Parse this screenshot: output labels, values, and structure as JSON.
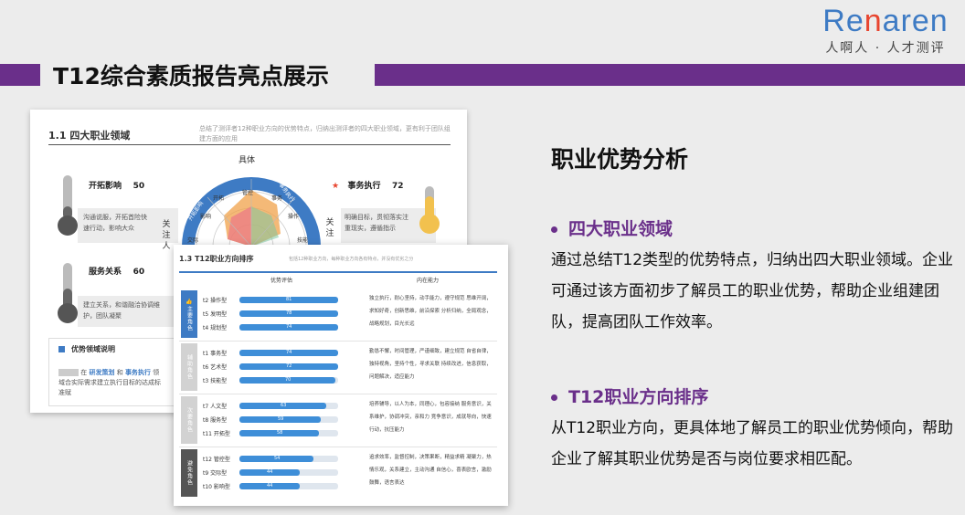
{
  "logo": {
    "word_pre": "Re",
    "word_accent": "n",
    "word_post": "aren",
    "sub": "人啊人 · 人才测评"
  },
  "slide_title": "T12综合素质报告亮点展示",
  "right": {
    "heading": "职业优势分析",
    "bullet1": "四大职业领域",
    "para1": "通过总结T12类型的优势特点，归纳出四大职业领域。企业可通过该方面初步了解员工的职业优势，帮助企业组建团队，提高团队工作效率。",
    "bullet2": "T12职业方向排序",
    "para2": "从T12职业方向，更具体地了解员工的职业优势倾向，帮助企业了解其职业优势是否与岗位要求相匹配。"
  },
  "card1": {
    "title": "1.1 四大职业领域",
    "desc": "总结了测评者12种职业方向的优势特点，归纳出测评者的四大职业领域，更有利于团队组建方面的应用",
    "domains": [
      {
        "name": "开拓影响",
        "score": "50",
        "text": "沟通说服，开拓首险快速行动，影响大众"
      },
      {
        "name": "事务执行",
        "score": "72",
        "text": "明确目标，贯彻落实注重现实，遵循指示"
      },
      {
        "name": "服务关系",
        "score": "60",
        "text": "建立关系，和谐融洽协调维护，团队凝聚"
      }
    ],
    "star": "★",
    "vert_label": "关注人",
    "vert_label2": "关注",
    "radar": {
      "top": "具体",
      "arc_left": "开拓影响",
      "arc_right": "事务执行",
      "items": [
        "管控",
        "开拓",
        "事务",
        "影响",
        "操作",
        "交际",
        "技能"
      ]
    },
    "legend_title": "优势领域说明",
    "legend_prefix": "在",
    "legend_hl1": "研发策划",
    "legend_mid": "和",
    "legend_hl2": "事务执行",
    "legend_post": "领域合实际需求建立执行目标的达成标准赋"
  },
  "card2": {
    "title": "1.3 T12职业方向排序",
    "desc": "包括12种职业方向，每种职业方向各有特点，并没有优劣之分",
    "col1": "优势评估",
    "col2": "内在能力",
    "groups": [
      {
        "label": "主要角色",
        "color": "#3e7bc4",
        "icon": "👍",
        "rows": [
          {
            "label": "t2 操作型",
            "value": 81
          },
          {
            "label": "t5 发明型",
            "value": 78
          },
          {
            "label": "t4 规划型",
            "value": 74
          }
        ],
        "ability": "独立执行，耐心坚持，动手能力，遵守规范 思维开阔，求知好奇，创新思维，前沿探索 分析归纳，全局观念，战略规划，目光长远"
      },
      {
        "label": "辅助角色",
        "color": "#d2d2d2",
        "icon": "",
        "rows": [
          {
            "label": "t1 事务型",
            "value": 74
          },
          {
            "label": "t6 艺术型",
            "value": 72
          },
          {
            "label": "t3 技能型",
            "value": 70
          }
        ],
        "ability": "勤恳不懈，时间管理，严谨细致，建立规范 自省自律，独特视角，坚持个性，寻求关联 持续改进，信息获取，问题解决，适应能力"
      },
      {
        "label": "次要角色",
        "color": "#d2d2d2",
        "icon": "",
        "rows": [
          {
            "label": "t7 人文型",
            "value": 63
          },
          {
            "label": "t8 服务型",
            "value": 59
          },
          {
            "label": "t11 开拓型",
            "value": 58
          }
        ],
        "ability": "培养辅导，以人为本，同理心，包容接纳 服务意识，关系维护，协调冲突，亲和力 竞争意识，成就导向，快速行动，抗压能力"
      },
      {
        "label": "避免角色",
        "color": "#555555",
        "icon": "",
        "rows": [
          {
            "label": "t12 管控型",
            "value": 54
          },
          {
            "label": "t9 交际型",
            "value": 44
          },
          {
            "label": "t10 影响型",
            "value": 44
          }
        ],
        "ability": "追求效率，监督控制，决策果断，精益求精 凝聚力，热情乐观，关系建立，主动沟通 自信心，喜表欧言，激励鼓舞，语言表达"
      }
    ]
  },
  "colors": {
    "purple": "#6a2f8a",
    "blue": "#3e7bc4",
    "bar": "#3e8ed8",
    "gold": "#f2c14e",
    "red": "#e8452f"
  }
}
